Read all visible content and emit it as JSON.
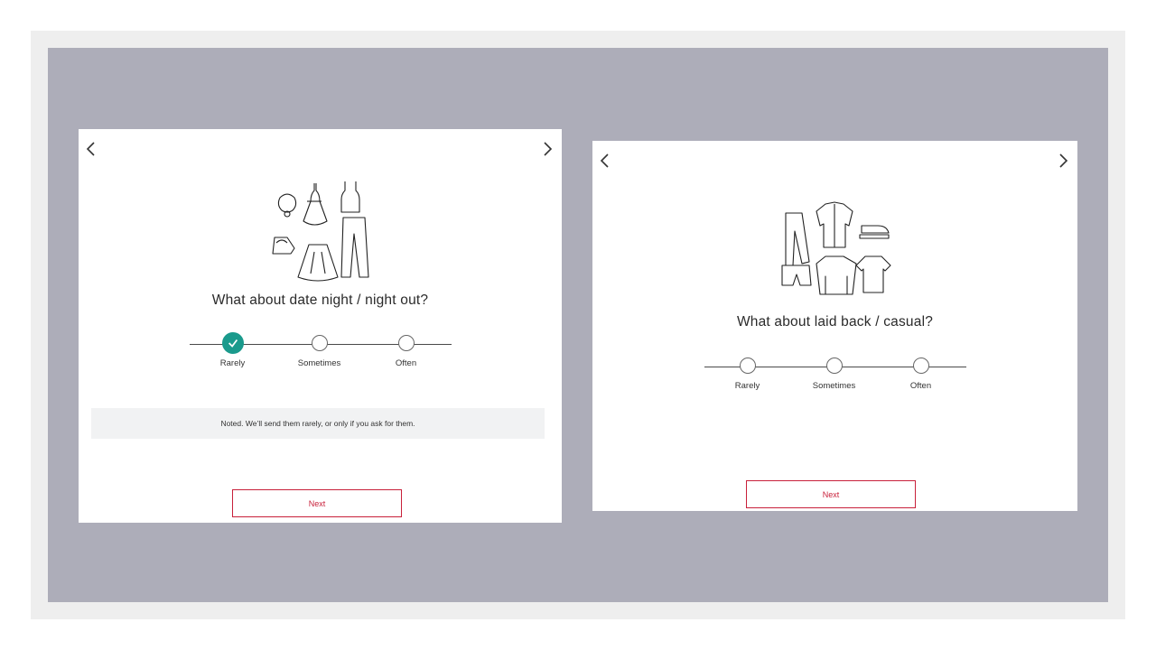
{
  "cards": [
    {
      "question": "What about date night / night out?",
      "scale": {
        "options": [
          "Rarely",
          "Sometimes",
          "Often"
        ],
        "selected": "Rarely"
      },
      "note": "Noted. We’ll send them rarely, or only if you ask for them.",
      "next_label": "Next",
      "illustration": "dressy-clothes-illustration"
    },
    {
      "question": "What about laid back / casual?",
      "scale": {
        "options": [
          "Rarely",
          "Sometimes",
          "Often"
        ],
        "selected": null
      },
      "next_label": "Next",
      "illustration": "casual-clothes-illustration"
    }
  ],
  "colors": {
    "accent": "#c8203a",
    "selected": "#1a9a8c",
    "backdrop": "#adadb9",
    "note_bg": "#f1f2f3"
  }
}
